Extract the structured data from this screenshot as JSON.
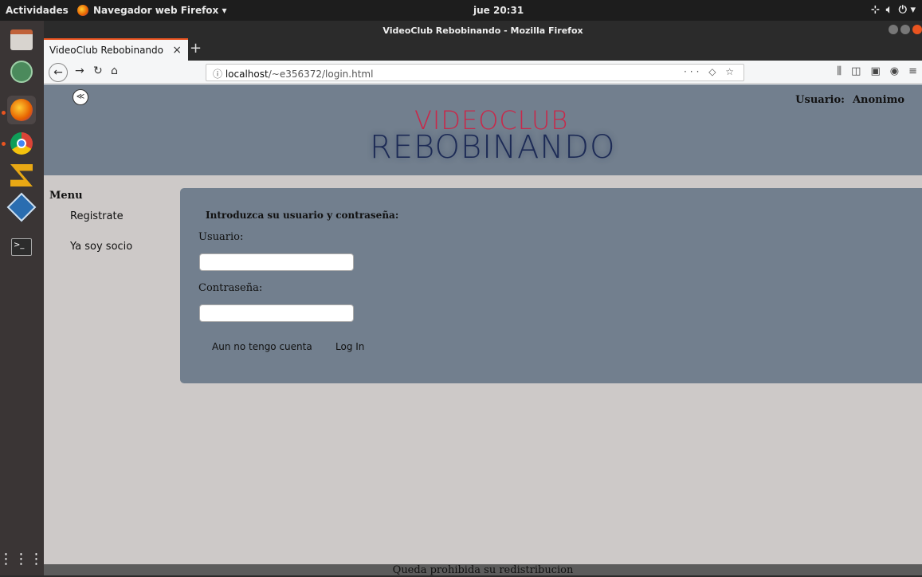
{
  "topbar": {
    "activities": "Actividades",
    "app_name": "Navegador web Firefox ▾",
    "clock": "jue 20:31",
    "system_icons": [
      "network-icon",
      "volume-icon",
      "power-icon"
    ]
  },
  "window": {
    "title": "VideoClub Rebobinando - Mozilla Firefox"
  },
  "tabs": [
    {
      "label": "VideoClub Rebobinando"
    }
  ],
  "navbar": {
    "url_prefix": "localhost",
    "url_path": "/~e356372/login.html"
  },
  "page": {
    "user_label": "Usuario:",
    "user_name": "Anonimo",
    "logo_line1": "VIDEOCLUB",
    "logo_line2": "REBOBINANDO",
    "menu_title": "Menu",
    "menu_items": [
      "Registrate",
      "Ya soy socio"
    ],
    "login_title": "Introduzca su usuario y contraseña:",
    "username_label": "Usuario:",
    "password_label": "Contraseña:",
    "no_account_link": "Aun no tengo cuenta",
    "login_link": "Log In",
    "footer": "Queda prohibida su redistribucion"
  },
  "colors": {
    "header_bg": "#727f8e",
    "page_bg": "#cdc9c8",
    "logo_red": "#c8284a",
    "logo_navy": "#1c2a55",
    "accent": "#e95420"
  }
}
